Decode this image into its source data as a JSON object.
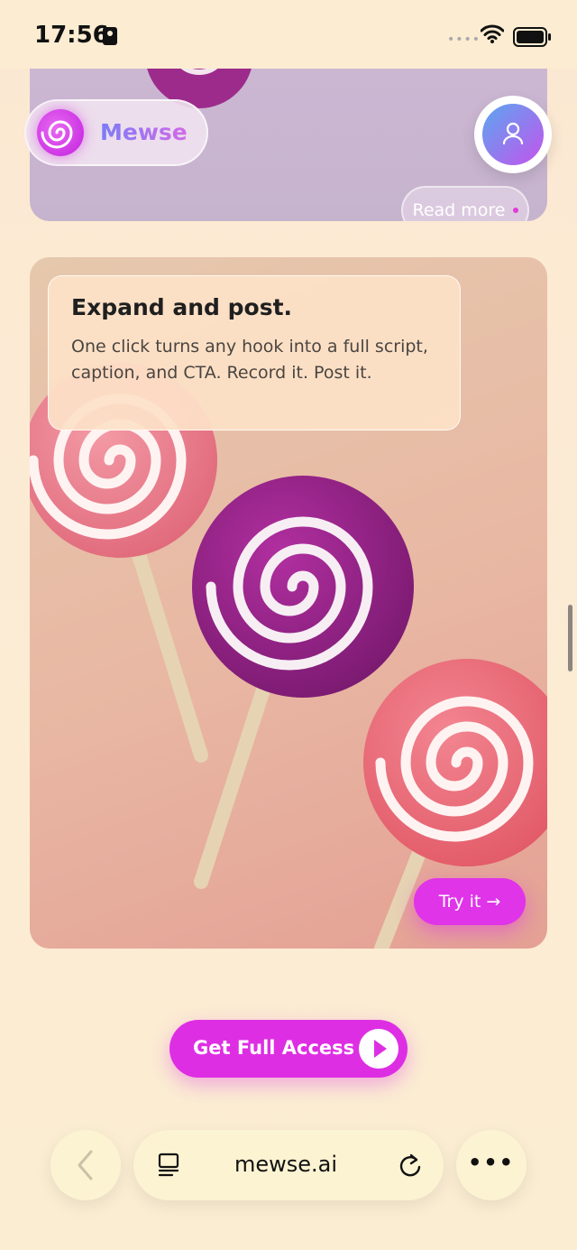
{
  "status_bar": {
    "time": "17:56"
  },
  "brand": {
    "name": "Mewse"
  },
  "top_card": {
    "read_more_label": "Read more"
  },
  "feature_card": {
    "title": "Expand and post.",
    "description": "One click turns any hook into a full script, caption, and CTA. Record it. Post it.",
    "try_label": "Try it →"
  },
  "cta": {
    "label": "Get Full Access"
  },
  "browser": {
    "url": "mewse.ai"
  },
  "colors": {
    "accent": "#de2ee4",
    "background": "#fbe8d2",
    "pill": "#fcf3d2"
  }
}
